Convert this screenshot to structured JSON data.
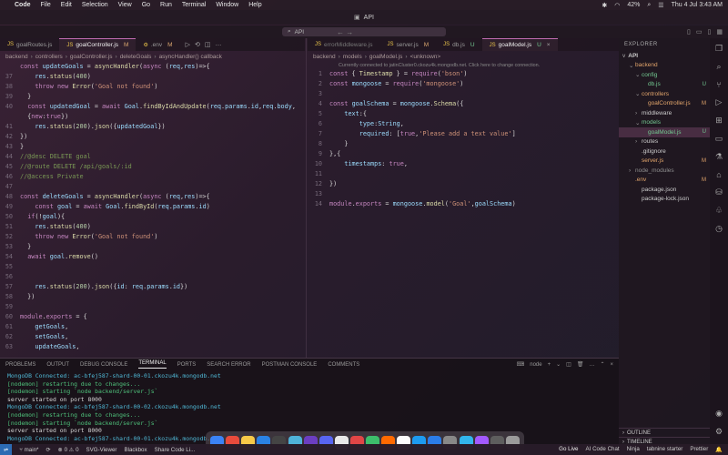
{
  "menubar": {
    "app": "Code",
    "items": [
      "File",
      "Edit",
      "Selection",
      "View",
      "Go",
      "Run",
      "Terminal",
      "Window",
      "Help"
    ],
    "battery": "42%",
    "datetime": "Thu 4 Jul  3:43 AM"
  },
  "window": {
    "title": "API"
  },
  "commandbar": {
    "search_text": "API"
  },
  "left_tabs": [
    {
      "label": "goalRoutes.js",
      "badge": ""
    },
    {
      "label": "goalController.js",
      "badge": "M"
    },
    {
      "label": ".env",
      "badge": "M"
    }
  ],
  "right_tabs": [
    {
      "label": "errorMiddleware.js",
      "badge": ""
    },
    {
      "label": "server.js",
      "badge": "M"
    },
    {
      "label": "db.js",
      "badge": "U"
    },
    {
      "label": "goalModel.js",
      "badge": "U"
    }
  ],
  "left_breadcrumb": [
    "backend",
    "controllers",
    "goalController.js",
    "deleteGoals",
    "asyncHandler() callback"
  ],
  "right_breadcrumb": [
    "backend",
    "models",
    "goalModel.js",
    "<unknown>"
  ],
  "right_hint": "Currently connected to jatinCluster0.ckozu4k.mongodb.net. Click here to change connection.",
  "left_code": [
    {
      "n": "",
      "t": "const updateGoals = asyncHandler(async (req,res)=>{"
    },
    {
      "n": "37",
      "t": "    res.status(400)"
    },
    {
      "n": "38",
      "t": "    throw new Error('Goal not found')"
    },
    {
      "n": "39",
      "t": "  }"
    },
    {
      "n": "40",
      "t": "  const updatedGoal = await Goal.findByIdAndUpdate(req.params.id,req.body,"
    },
    {
      "n": "",
      "t": "  {new:true})"
    },
    {
      "n": "41",
      "t": "    res.status(200).json({updatedGoal})"
    },
    {
      "n": "42",
      "t": "})"
    },
    {
      "n": "43",
      "t": "}"
    },
    {
      "n": "44",
      "t": "//@desc DELETE goal"
    },
    {
      "n": "45",
      "t": "//@route DELETE /api/goals/:id"
    },
    {
      "n": "46",
      "t": "//@access Private"
    },
    {
      "n": "47",
      "t": ""
    },
    {
      "n": "48",
      "t": "const deleteGoals = asyncHandler(async (req,res)=>{"
    },
    {
      "n": "49",
      "t": "    const goal = await Goal.findById(req.params.id)"
    },
    {
      "n": "50",
      "t": "  if(!goal){"
    },
    {
      "n": "51",
      "t": "    res.status(400)"
    },
    {
      "n": "52",
      "t": "    throw new Error('Goal not found')"
    },
    {
      "n": "53",
      "t": "  }"
    },
    {
      "n": "54",
      "t": "  await goal.remove()"
    },
    {
      "n": "55",
      "t": ""
    },
    {
      "n": "56",
      "t": ""
    },
    {
      "n": "57",
      "t": "    res.status(200).json({id: req.params.id})"
    },
    {
      "n": "58",
      "t": "  })"
    },
    {
      "n": "59",
      "t": ""
    },
    {
      "n": "60",
      "t": "module.exports = {"
    },
    {
      "n": "61",
      "t": "    getGoals,"
    },
    {
      "n": "62",
      "t": "    setGoals,"
    },
    {
      "n": "63",
      "t": "    updateGoals,"
    }
  ],
  "right_code": [
    {
      "n": "1",
      "t": "const { Timestamp } = require('bson')"
    },
    {
      "n": "2",
      "t": "const mongoose = require('mongoose')"
    },
    {
      "n": "3",
      "t": ""
    },
    {
      "n": "4",
      "t": "const goalSchema = mongoose.Schema({"
    },
    {
      "n": "5",
      "t": "    text:{"
    },
    {
      "n": "6",
      "t": "        type:String,"
    },
    {
      "n": "7",
      "t": "        required: [true,'Please add a text value']"
    },
    {
      "n": "8",
      "t": "    }"
    },
    {
      "n": "9",
      "t": "},{"
    },
    {
      "n": "10",
      "t": "    timestamps: true,"
    },
    {
      "n": "11",
      "t": ""
    },
    {
      "n": "12",
      "t": "})"
    },
    {
      "n": "13",
      "t": ""
    },
    {
      "n": "14",
      "t": "module.exports = mongoose.model('Goal',goalSchema)"
    }
  ],
  "explorer": {
    "header": "EXPLORER",
    "root": "API",
    "items": [
      {
        "label": "backend",
        "indent": 1,
        "color": "orange",
        "badge": "",
        "arrow": "v"
      },
      {
        "label": "config",
        "indent": 2,
        "color": "green",
        "badge": "",
        "arrow": "v"
      },
      {
        "label": "db.js",
        "indent": 3,
        "color": "green",
        "badge": "U",
        "arrow": ""
      },
      {
        "label": "controllers",
        "indent": 2,
        "color": "orange",
        "badge": "",
        "arrow": "v"
      },
      {
        "label": "goalController.js",
        "indent": 3,
        "color": "orange",
        "badge": "M",
        "arrow": ""
      },
      {
        "label": "middleware",
        "indent": 2,
        "color": "",
        "badge": "",
        "arrow": ">"
      },
      {
        "label": "models",
        "indent": 2,
        "color": "green",
        "badge": "",
        "arrow": "v"
      },
      {
        "label": "goalModel.js",
        "indent": 3,
        "color": "green",
        "badge": "U",
        "arrow": "",
        "selected": true
      },
      {
        "label": "routes",
        "indent": 2,
        "color": "",
        "badge": "",
        "arrow": ">"
      },
      {
        "label": ".gitignore",
        "indent": 2,
        "color": "",
        "badge": "",
        "arrow": ""
      },
      {
        "label": "server.js",
        "indent": 2,
        "color": "orange",
        "badge": "M",
        "arrow": ""
      },
      {
        "label": "node_modules",
        "indent": 1,
        "color": "gray",
        "badge": "",
        "arrow": ">"
      },
      {
        "label": ".env",
        "indent": 1,
        "color": "orange",
        "badge": "M",
        "arrow": ""
      },
      {
        "label": "package.json",
        "indent": 2,
        "color": "",
        "badge": "",
        "arrow": ""
      },
      {
        "label": "package-lock.json",
        "indent": 2,
        "color": "",
        "badge": "",
        "arrow": ""
      }
    ],
    "outline": "OUTLINE",
    "timeline": "TIMELINE"
  },
  "panel": {
    "tabs": [
      "PROBLEMS",
      "OUTPUT",
      "DEBUG CONSOLE",
      "TERMINAL",
      "PORTS",
      "SEARCH ERROR",
      "POSTMAN CONSOLE",
      "COMMENTS"
    ],
    "active_tab": "TERMINAL",
    "shell": "node",
    "lines": [
      "MongoDB Connected: ac-bfej587-shard-00-01.ckozu4k.mongodb.net",
      "[nodemon] restarting due to changes...",
      "[nodemon] starting `node backend/server.js`",
      "server started on port 8000",
      "MongoDB Connected: ac-bfej587-shard-00-02.ckozu4k.mongodb.net",
      "[nodemon] restarting due to changes...",
      "[nodemon] starting `node backend/server.js`",
      "server started on port 8000",
      "MongoDB Connected: ac-bfej587-shard-00-01.ckozu4k.mongodb.net"
    ]
  },
  "statusbar": {
    "branch": "main*",
    "errors": "0",
    "warnings": "0",
    "items": [
      "SVG-Viewer",
      "Blackbox",
      "Share Code Li..."
    ],
    "right_items": [
      "Go Live",
      "AI Code Chat",
      "Ninja",
      "tabnine starter",
      "Prettier"
    ]
  },
  "dock": {
    "colors": [
      "#3b83f6",
      "#e94b3c",
      "#f7c948",
      "#2a82e4",
      "#444",
      "#4fb3d9",
      "#6c3ec1",
      "#5865f2",
      "#e8e8e8",
      "#e14646",
      "#3dbe6b",
      "#ff6a00",
      "#fcfcfc",
      "#1d9bf0",
      "#2b7de9",
      "#888",
      "#32b6ec",
      "#a259ff",
      "#5e5e5e",
      "#9b9b9b"
    ]
  }
}
